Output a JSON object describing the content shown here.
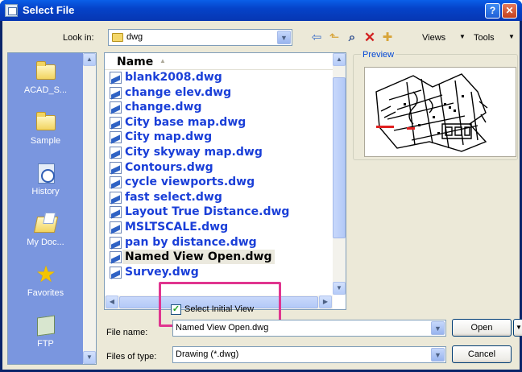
{
  "window": {
    "title": "Select File",
    "help_glyph": "?",
    "close_glyph": "✕"
  },
  "toolbar": {
    "look_in_label": "Look in:",
    "look_in_value": "dwg",
    "icons": [
      "back-icon",
      "up-one-level-icon",
      "search-web-icon",
      "delete-icon",
      "create-new-folder-icon"
    ],
    "views_label": "Views",
    "tools_label": "Tools"
  },
  "places": [
    {
      "label": "ACAD_S...",
      "icon": "folder-icon"
    },
    {
      "label": "Sample",
      "icon": "folder-icon"
    },
    {
      "label": "History",
      "icon": "history-icon"
    },
    {
      "label": "My Doc...",
      "icon": "my-documents-icon"
    },
    {
      "label": "Favorites",
      "icon": "star-icon"
    },
    {
      "label": "FTP",
      "icon": "ftp-icon"
    }
  ],
  "filelist": {
    "column_name": "Name",
    "files": [
      "blank2008.dwg",
      "change elev.dwg",
      "change.dwg",
      "City base map.dwg",
      "City map.dwg",
      "City skyway map.dwg",
      "Contours.dwg",
      "cycle viewports.dwg",
      "fast select.dwg",
      "Layout True Distance.dwg",
      "MSLTSCALE.dwg",
      "pan by distance.dwg",
      "Named View Open.dwg",
      "Survey.dwg"
    ],
    "selected": "Named View Open.dwg"
  },
  "preview": {
    "label": "Preview"
  },
  "options": {
    "select_initial_view_label": "Select Initial View",
    "select_initial_view_checked": true
  },
  "file_name": {
    "label": "File name:",
    "value": "Named View Open.dwg"
  },
  "files_of_type": {
    "label": "Files of type:",
    "value": "Drawing (*.dwg)"
  },
  "buttons": {
    "open": "Open",
    "cancel": "Cancel"
  },
  "colors": {
    "accent": "#0A246A",
    "highlight": "#E0358F",
    "link_text": "#1A3FD8"
  }
}
